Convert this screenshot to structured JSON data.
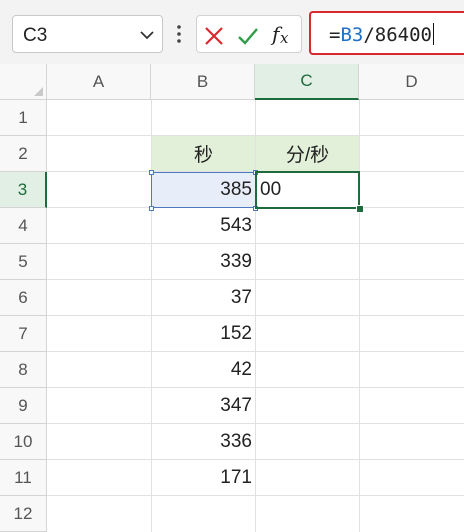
{
  "formula_bar": {
    "name_box": "C3",
    "name_box_icon": "chevron-down-icon",
    "more_icon": "more-vertical-icon",
    "cancel_icon": "cancel-x-icon",
    "enter_icon": "enter-check-icon",
    "fx_icon": "insert-function-icon",
    "formula_prefix": "=",
    "formula_ref": "B3",
    "formula_rest": "/86400",
    "colors": {
      "cancel": "#d9282e",
      "enter": "#2f9e47",
      "ref": "#1f6fc4",
      "input_border": "#d9282e"
    }
  },
  "grid": {
    "columns": [
      "A",
      "B",
      "C",
      "D"
    ],
    "active_column": "C",
    "rows": [
      "1",
      "2",
      "3",
      "4",
      "5",
      "6",
      "7",
      "8",
      "9",
      "10",
      "11",
      "12"
    ],
    "active_row": "3",
    "header_b2": "秒",
    "header_c2": "分/秒",
    "c3_editing_value": "00",
    "b_values": [
      "385",
      "543",
      "339",
      "37",
      "152",
      "42",
      "347",
      "336",
      "171"
    ],
    "colors": {
      "header_fill": "#e2f0d9",
      "active_header": "#1e6b3d",
      "ref_highlight": "#4d79c1"
    }
  }
}
